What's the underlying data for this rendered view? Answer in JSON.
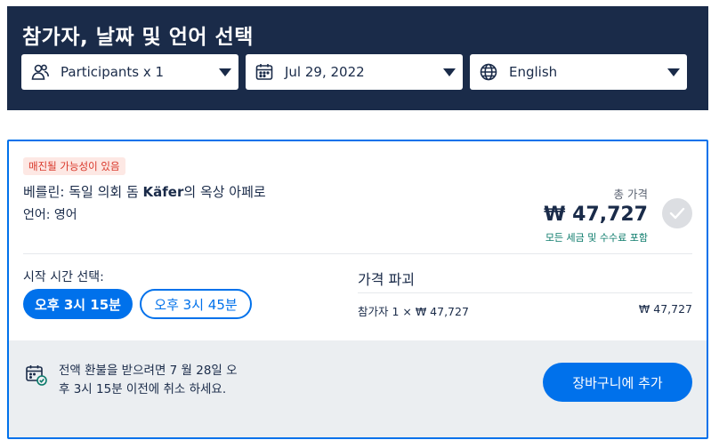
{
  "header": {
    "title": "참가자, 날짜 및 언어 선택",
    "participants": {
      "label": "Participants x 1",
      "icon": "users-icon"
    },
    "date": {
      "label": "Jul 29, 2022",
      "icon": "calendar-icon"
    },
    "language": {
      "label": "English",
      "icon": "globe-icon"
    }
  },
  "card": {
    "badge": "매진될 가능성이 있음",
    "title_pre": "베를린: 독일 의회 돔 ",
    "title_bold": "Käfer",
    "title_post": "의 옥상 아페로",
    "language_line": "언어: 영어",
    "total_label": "총 가격",
    "total_price": "₩ 47,727",
    "total_note": "모든 세금 및 수수료 포함",
    "start_time_label": "시작 시간 선택:",
    "times": [
      "오후 3시 15분",
      "오후 3시 45분"
    ],
    "selected_time_index": 0,
    "breakdown_title": "가격 파괴",
    "breakdown_item": "참가자 1 × ₩ 47,727",
    "breakdown_amount": "₩ 47,727",
    "refund_text": "전액 환불을 받으려면 7 월 28일 오후 3시 15분 이전에 취소 하세요.",
    "cart_button": "장바구니에 추가"
  },
  "colors": {
    "header_bg": "#1a2b49",
    "accent": "#0071eb",
    "badge_bg": "#fde8e4",
    "badge_text": "#d9372a",
    "note_green": "#0a7a6a",
    "footer_bg": "#ebeef1"
  }
}
